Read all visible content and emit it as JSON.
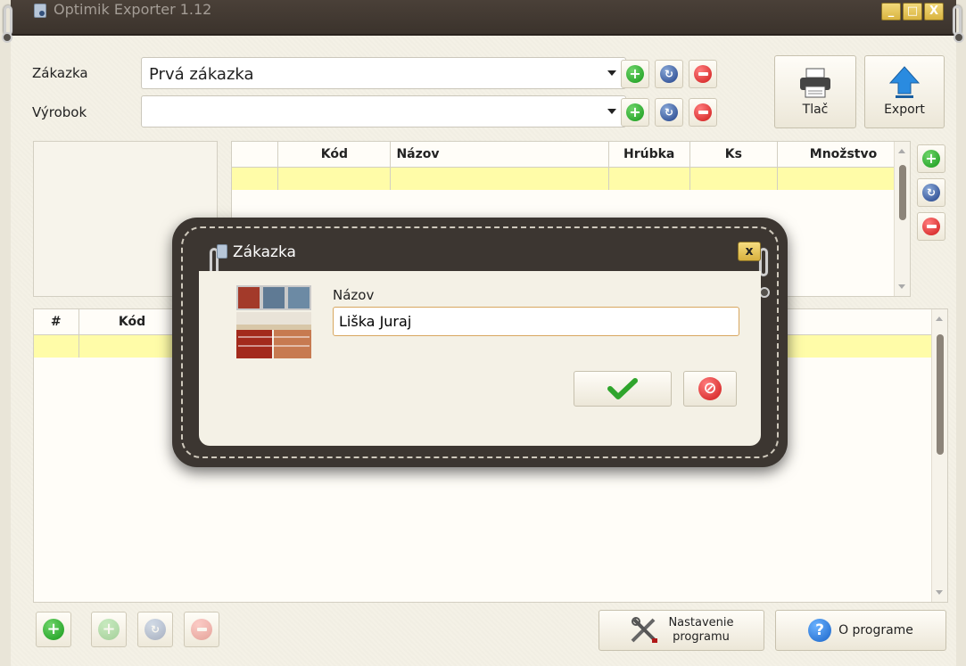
{
  "window": {
    "title": "Optimik Exporter 1.12",
    "min": "_",
    "max": "□",
    "close": "X"
  },
  "fields": {
    "zakazka_label": "Zákazka",
    "zakazka_value": "Prvá zákazka",
    "vyrobok_label": "Výrobok",
    "vyrobok_value": ""
  },
  "toolbar": {
    "print_label": "Tlač",
    "export_label": "Export"
  },
  "upper_table": {
    "columns": [
      "",
      "Kód",
      "Názov",
      "Hrúbka",
      "Ks",
      "Množstvo"
    ]
  },
  "lower_table": {
    "columns": [
      "#",
      "Kód"
    ]
  },
  "bottom": {
    "settings_label_1": "Nastavenie",
    "settings_label_2": "programu",
    "about_label": "O programe"
  },
  "dialog": {
    "title": "Zákazka",
    "close": "x",
    "field_label": "Názov",
    "field_value": "Liška Juraj"
  },
  "icons": {
    "add": "plus-icon",
    "edit": "refresh-icon",
    "delete": "minus-icon",
    "ok": "check-icon",
    "cancel": "cancel-icon"
  }
}
